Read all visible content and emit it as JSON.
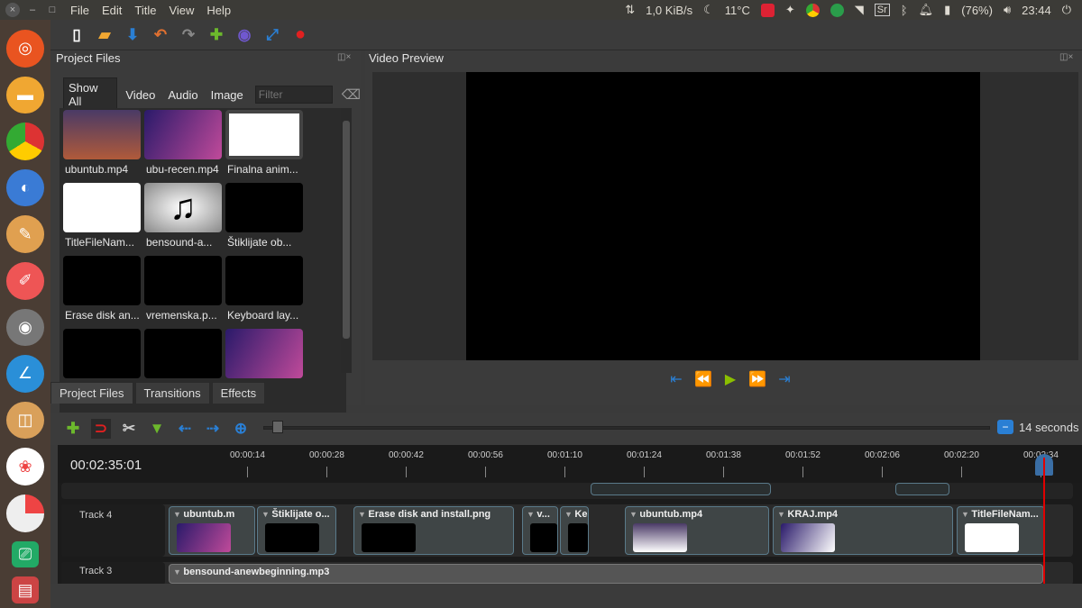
{
  "window_controls": {
    "close": "×",
    "minimize": "–",
    "maximize": "□"
  },
  "menubar": [
    "File",
    "Edit",
    "Title",
    "View",
    "Help"
  ],
  "tray": {
    "net_speed": "1,0 KiB/s",
    "temperature": "11°C",
    "keyboard_layout": "Sr",
    "battery": "(76%)",
    "clock": "23:44"
  },
  "project_files": {
    "title": "Project Files",
    "filters": [
      "Show All",
      "Video",
      "Audio",
      "Image"
    ],
    "filter_placeholder": "Filter",
    "files": [
      {
        "name": "ubuntub.mp4"
      },
      {
        "name": "ubu-recen.mp4"
      },
      {
        "name": "Finalna anim..."
      },
      {
        "name": "TitleFileNam..."
      },
      {
        "name": "bensound-a..."
      },
      {
        "name": "Štiklijate ob..."
      },
      {
        "name": "Erase disk an..."
      },
      {
        "name": "vremenska.p..."
      },
      {
        "name": "Keyboard lay..."
      },
      {
        "name": ""
      },
      {
        "name": ""
      },
      {
        "name": ""
      }
    ]
  },
  "bottom_tabs": [
    "Project Files",
    "Transitions",
    "Effects"
  ],
  "video_preview": {
    "title": "Video Preview"
  },
  "timeline": {
    "zoom_label": "14 seconds",
    "current_time": "00:02:35:01",
    "ticks": [
      "00:00:14",
      "00:00:28",
      "00:00:42",
      "00:00:56",
      "00:01:10",
      "00:01:24",
      "00:01:38",
      "00:01:52",
      "00:02:06",
      "00:02:20",
      "00:02:34"
    ],
    "tracks": [
      {
        "label": "Track 4",
        "clips": [
          "ubuntub.m",
          "Štiklijate o...",
          "Erase disk and install.png",
          "v...",
          "Ke",
          "ubuntub.mp4",
          "KRAJ.mp4",
          "TitleFileNam..."
        ]
      },
      {
        "label": "Track 3",
        "clips": [
          "bensound-anewbeginning.mp3"
        ]
      }
    ]
  },
  "colors": {
    "accent": "#2a7fd4",
    "playhead": "#e00000",
    "record": "#e02020",
    "play": "#8bbf00"
  }
}
